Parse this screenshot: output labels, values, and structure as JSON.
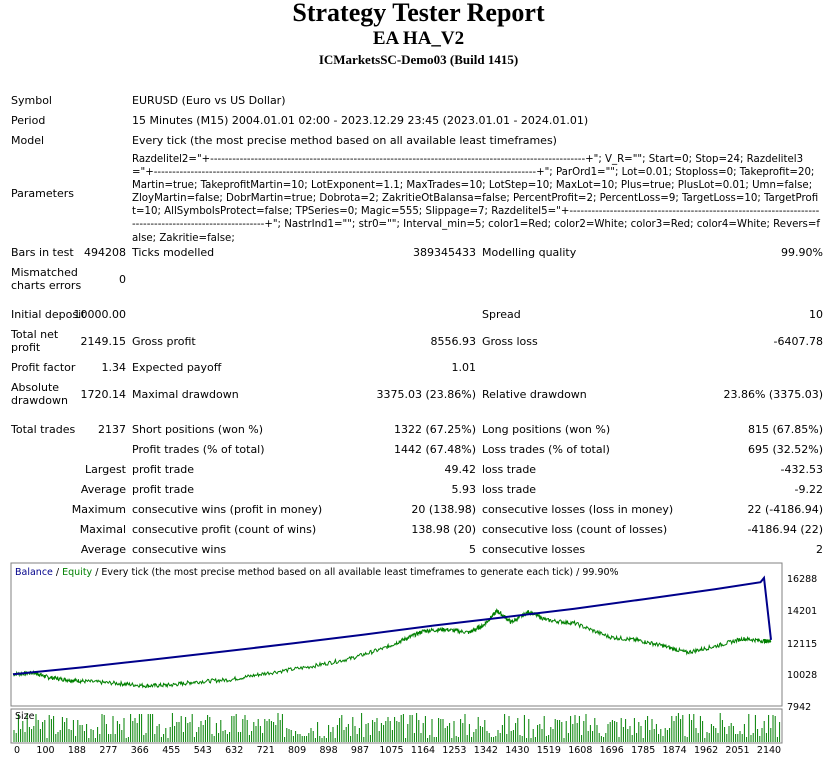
{
  "header": {
    "title": "Strategy Tester Report",
    "subtitle": "EA HA_V2",
    "build": "ICMarketsSC-Demo03 (Build 1415)"
  },
  "info": {
    "symbol_label": "Symbol",
    "symbol_value": "EURUSD (Euro vs US Dollar)",
    "period_label": "Period",
    "period_value": "15 Minutes (M15) 2004.01.01 02:00 - 2023.12.29 23:45 (2023.01.01 - 2024.01.01)",
    "model_label": "Model",
    "model_value": "Every tick (the most precise method based on all available least timeframes)",
    "parameters_label": "Parameters",
    "parameters_value": "Razdelitel2=\"+------------------------------------------------------------------------------------------------------+\"; V_R=\"\"; Start=0; Stop=24; Razdelitel3=\"+--------------------------------------------------------------------------------------------------------+\"; ParOrd1=\"\"; Lot=0.01; Stoploss=0; Takeprofit=20; Martin=true; TakeprofitMartin=10; LotExponent=1.1; MaxTrades=10; LotStep=10; MaxLot=10; Plus=true; PlusLot=0.01; Umn=false; ZloyMartin=false; DobrMartin=true; Dobrota=2; ZakritieOtBalansa=false; PercentProfit=2; PercentLoss=9; TargetLoss=10; TargetProfit=10; AllSymbolsProtect=false; TPSeries=0; Magic=555; Slippage=7; Razdelitel5=\"+--------------------------------------------------------------------------------------------------------+\"; NastrInd1=\"\"; str0=\"\"; Interval_min=5; color1=Red; color2=White; color3=Red; color4=White; Revers=false; Zakritie=false;"
  },
  "stats": {
    "bars_label": "Bars in test",
    "bars_value": "494208",
    "ticks_label": "Ticks modelled",
    "ticks_value": "389345433",
    "quality_label": "Modelling quality",
    "quality_value": "99.90%",
    "mismatch_label_1": "Mismatched",
    "mismatch_label_2": "charts errors",
    "mismatch_value": "0",
    "deposit_label": "Initial deposit",
    "deposit_value": "10000.00",
    "spread_label": "Spread",
    "spread_value": "10",
    "netprofit_label_1": "Total net",
    "netprofit_label_2": "profit",
    "netprofit_value": "2149.15",
    "grossprofit_label": "Gross profit",
    "grossprofit_value": "8556.93",
    "grossloss_label": "Gross loss",
    "grossloss_value": "-6407.78",
    "pf_label": "Profit factor",
    "pf_value": "1.34",
    "payoff_label": "Expected payoff",
    "payoff_value": "1.01",
    "absdd_label_1": "Absolute",
    "absdd_label_2": "drawdown",
    "absdd_value": "1720.14",
    "maxdd_label": "Maximal drawdown",
    "maxdd_value": "3375.03 (23.86%)",
    "reldd_label": "Relative drawdown",
    "reldd_value": "23.86% (3375.03)",
    "trades_label": "Total trades",
    "trades_value": "2137",
    "short_label": "Short positions (won %)",
    "short_value": "1322 (67.25%)",
    "long_label": "Long positions (won %)",
    "long_value": "815 (67.85%)",
    "ptrades_label": "Profit trades (% of total)",
    "ptrades_value": "1442 (67.48%)",
    "ltrades_label": "Loss trades (% of total)",
    "ltrades_value": "695 (32.52%)",
    "largest_label": "Largest",
    "largest_pt_label": "profit trade",
    "largest_pt_value": "49.42",
    "largest_lt_label": "loss trade",
    "largest_lt_value": "-432.53",
    "average_label": "Average",
    "average_pt_label": "profit trade",
    "average_pt_value": "5.93",
    "average_lt_label": "loss trade",
    "average_lt_value": "-9.22",
    "maximum_label": "Maximum",
    "maxwins_label": "consecutive wins (profit in money)",
    "maxwins_value": "20 (138.98)",
    "maxlosses_label": "consecutive losses (loss in money)",
    "maxlosses_value": "22 (-4186.94)",
    "maximal_label": "Maximal",
    "maxprofit_label": "consecutive profit (count of wins)",
    "maxprofit_value": "138.98 (20)",
    "maxloss_label": "consecutive loss (count of losses)",
    "maxloss_value": "-4186.94 (22)",
    "average2_label": "Average",
    "avgwins_label": "consecutive wins",
    "avgwins_value": "5",
    "avglosses_label": "consecutive losses",
    "avglosses_value": "2"
  },
  "chart_data": {
    "type": "line",
    "legend": {
      "balance": "Balance",
      "sep1": " / ",
      "equity": "Equity",
      "rest": " / Every tick (the most precise method based on all available least timeframes to generate each tick) / 99.90%"
    },
    "y_ticks": [
      "16288",
      "14201",
      "12115",
      "10028",
      "7942"
    ],
    "ylim": [
      7942,
      16288
    ],
    "x_ticks": [
      "0",
      "100",
      "188",
      "277",
      "366",
      "455",
      "543",
      "632",
      "721",
      "809",
      "898",
      "987",
      "1075",
      "1164",
      "1253",
      "1342",
      "1430",
      "1519",
      "1608",
      "1696",
      "1785",
      "1874",
      "1962",
      "2051",
      "2140"
    ],
    "xlim": [
      0,
      2180
    ],
    "size_label": "Size",
    "colors": {
      "balance": "#00008b",
      "equity": "#008000",
      "size": "#008000"
    },
    "series": [
      {
        "name": "Balance",
        "x": [
          0,
          200,
          400,
          600,
          800,
          1000,
          1200,
          1400,
          1600,
          1800,
          2000,
          2130,
          2140,
          2160
        ],
        "y": [
          10000,
          10450,
          10950,
          11470,
          12000,
          12560,
          13150,
          13690,
          14230,
          14860,
          15500,
          15950,
          16230,
          12220
        ]
      },
      {
        "name": "Equity",
        "x": [
          0,
          60,
          100,
          150,
          200,
          300,
          380,
          450,
          520,
          620,
          720,
          850,
          960,
          1060,
          1120,
          1170,
          1230,
          1300,
          1340,
          1380,
          1420,
          1470,
          1520,
          1600,
          1700,
          1780,
          1850,
          1920,
          2000,
          2080,
          2140,
          2160
        ],
        "y": [
          10000,
          10100,
          9800,
          9650,
          9550,
          9400,
          9250,
          9300,
          9500,
          9650,
          10050,
          10500,
          11000,
          11700,
          12300,
          12800,
          12900,
          12700,
          13150,
          14100,
          13350,
          14050,
          13500,
          13300,
          12400,
          12200,
          11850,
          11400,
          11800,
          12300,
          12150,
          12150
        ]
      }
    ]
  }
}
